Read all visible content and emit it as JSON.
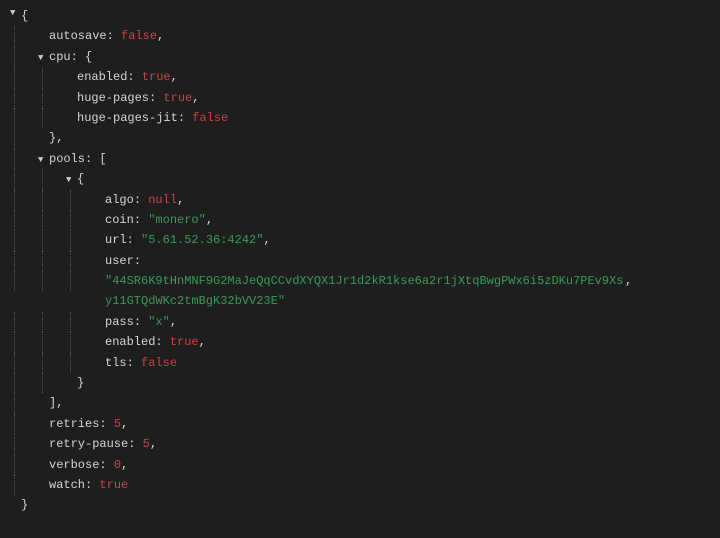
{
  "glyphs": {
    "down": "▼"
  },
  "punct": {
    "colon_sp": ": ",
    "comma": ",",
    "lbrace": "{",
    "rbrace": "}",
    "lbracket": "[",
    "rbracket": "]"
  },
  "root": {
    "autosave": {
      "key": "autosave",
      "value": "false",
      "type": "bool"
    },
    "cpu": {
      "key": "cpu",
      "enabled": {
        "key": "enabled",
        "value": "true",
        "type": "bool"
      },
      "huge_pages": {
        "key": "huge-pages",
        "value": "true",
        "type": "bool"
      },
      "huge_pages_jit": {
        "key": "huge-pages-jit",
        "value": "false",
        "type": "bool"
      }
    },
    "pools": {
      "key": "pools",
      "item0": {
        "algo": {
          "key": "algo",
          "value": "null",
          "type": "null"
        },
        "coin": {
          "key": "coin",
          "value": "\"monero\"",
          "type": "str"
        },
        "url": {
          "key": "url",
          "value": "\"5.61.52.36:4242\"",
          "type": "str"
        },
        "user": {
          "key": "user",
          "value": "\"44SR6K9tHnMNF9G2MaJeQqCCvdXYQX1Jr1d2kR1kse6a2r1jXtqBwgPWx6i5zDKu7PEv9Xsy11GTQdWKc2tmBgK32bVV23E\"",
          "type": "str"
        },
        "pass": {
          "key": "pass",
          "value": "\"x\"",
          "type": "str"
        },
        "enabled": {
          "key": "enabled",
          "value": "true",
          "type": "bool"
        },
        "tls": {
          "key": "tls",
          "value": "false",
          "type": "bool"
        }
      }
    },
    "retries": {
      "key": "retries",
      "value": "5",
      "type": "num"
    },
    "retry_pause": {
      "key": "retry-pause",
      "value": "5",
      "type": "num"
    },
    "verbose": {
      "key": "verbose",
      "value": "0",
      "type": "num"
    },
    "watch": {
      "key": "watch",
      "value": "true",
      "type": "bool"
    }
  }
}
